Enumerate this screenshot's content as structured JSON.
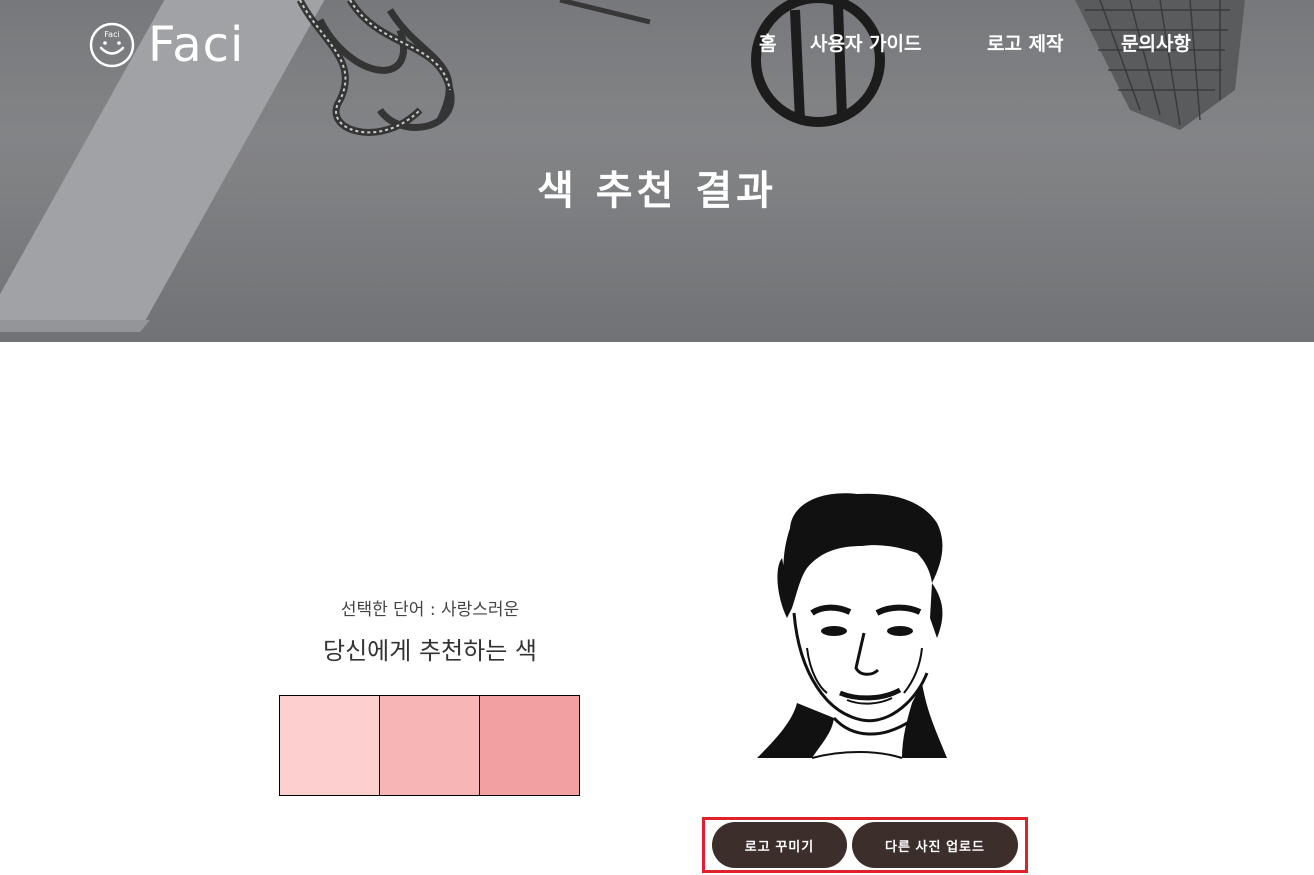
{
  "header": {
    "logo_text": "Faci",
    "logo_badge": "Faci",
    "nav": [
      "홈",
      "사용자 가이드",
      "로고 제작",
      "문의사항"
    ],
    "page_title": "색 추천 결과"
  },
  "result": {
    "selected_word_label": "선택한 단어 : 사랑스러운",
    "recommend_title": "당신에게 추천하는 색",
    "swatches": [
      "#fdd0d0",
      "#f7b5b5",
      "#f3a0a1"
    ]
  },
  "actions": {
    "decorate_label": "로고 꾸미기",
    "upload_label": "다른 사진 업로드"
  },
  "colors": {
    "button_bg": "#3b2e2b",
    "highlight_border": "#e0202a"
  }
}
